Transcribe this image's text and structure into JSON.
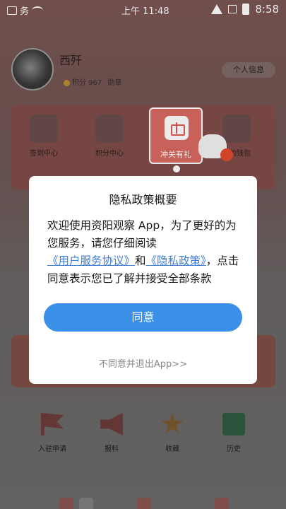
{
  "status_bar": {
    "left_text": "务",
    "time": "上午 11:48",
    "clock": "8:58"
  },
  "profile": {
    "username": "西歼",
    "points_label": "积分 967",
    "badge_label": "勋章",
    "info_button": "个人信息"
  },
  "grid": {
    "items": [
      "签到中心",
      "积分中心",
      "冲关有礼",
      "我的钱包"
    ],
    "highlight_label": "冲关有礼"
  },
  "bottom_nav": {
    "items": [
      "入驻申请",
      "报料",
      "收藏",
      "历史"
    ]
  },
  "dialog": {
    "title": "隐私政策概要",
    "body_part1": "欢迎使用资阳观察 App，为了更好的为您服务，请您仔细阅读",
    "link1": "《用户服务协议》",
    "body_part2": "和",
    "link2": "《隐私政策》",
    "body_part3": "，点击同意表示您已了解并接受全部条款",
    "agree_button": "同意",
    "disagree_button": "不同意并退出App>>"
  }
}
